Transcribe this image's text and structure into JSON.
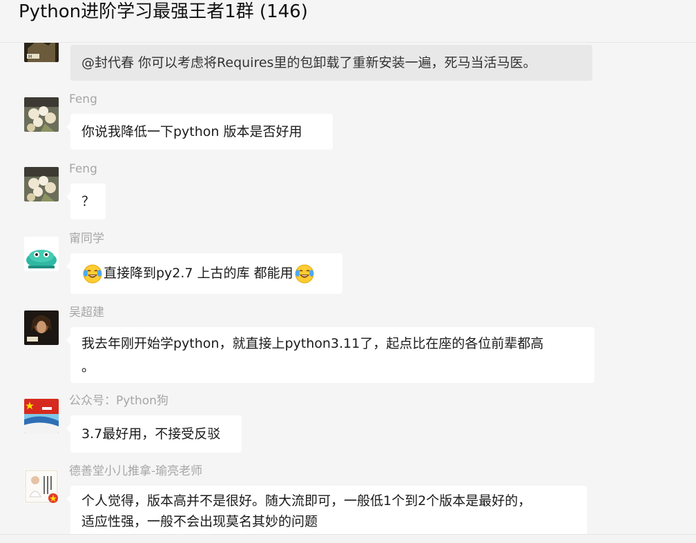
{
  "window": {
    "title": "Python进阶学习最强王者1群 (146)"
  },
  "messages": [
    {
      "sender": "",
      "avatar": "dark-comic-avatar",
      "quoted": true,
      "lines": [
        "@封代春 你可以考虑将Requires里的包卸载了重新安装一遍，死马当活马医。"
      ]
    },
    {
      "sender": "Feng",
      "avatar": "flower-bouquet-avatar",
      "lines": [
        "你说我降低一下python 版本是否好用"
      ]
    },
    {
      "sender": "Feng",
      "avatar": "flower-bouquet-avatar",
      "lines": [
        "？"
      ]
    },
    {
      "sender": "甯同学",
      "avatar": "green-shoes-avatar",
      "pre": "直接降到py2.7 上古的库 都能用",
      "emoji": "tears-of-joy-emoji"
    },
    {
      "sender": "吴超建",
      "avatar": "warrior-avatar",
      "lines": [
        "我去年刚开始学python，就直接上python3.11了，起点比在座的各位前辈都高",
        "。"
      ]
    },
    {
      "sender": "公众号：Python狗",
      "avatar": "flag-landscape-avatar",
      "lines": [
        "3.7最好用，不接受反驳"
      ]
    },
    {
      "sender": "德善堂小儿推拿-瑜亮老师",
      "avatar": "doctor-avatar",
      "lines": [
        "个人觉得，版本高并不是很好。随大流即可，一般低1个到2个版本是最好的，",
        "适应性强，一般不会出现莫名其妙的问题"
      ]
    }
  ]
}
